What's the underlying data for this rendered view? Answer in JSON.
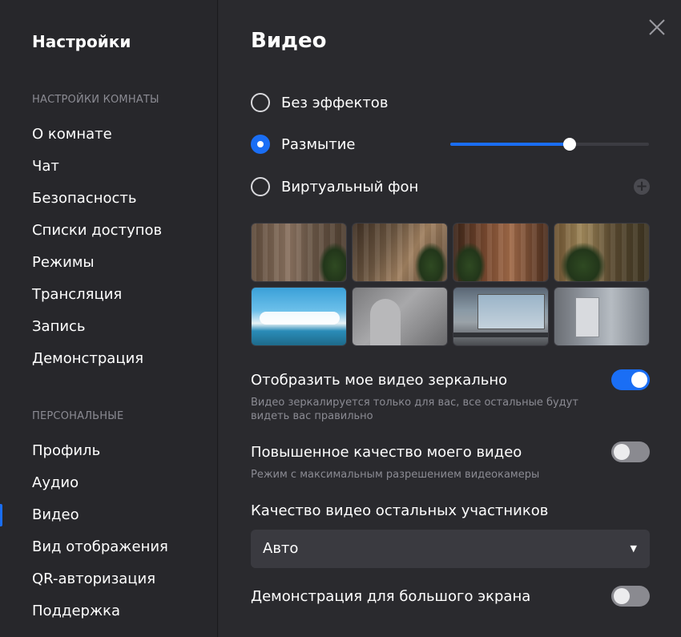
{
  "sidebar": {
    "title": "Настройки",
    "room_section": "НАСТРОЙКИ КОМНАТЫ",
    "room_items": [
      {
        "label": "О комнате"
      },
      {
        "label": "Чат"
      },
      {
        "label": "Безопасность"
      },
      {
        "label": "Списки доступов"
      },
      {
        "label": "Режимы"
      },
      {
        "label": "Трансляция"
      },
      {
        "label": "Запись"
      },
      {
        "label": "Демонстрация"
      }
    ],
    "personal_section": "ПЕРСОНАЛЬНЫЕ",
    "personal_items": [
      {
        "label": "Профиль"
      },
      {
        "label": "Аудио"
      },
      {
        "label": "Видео"
      },
      {
        "label": "Вид отображения"
      },
      {
        "label": "QR-авторизация"
      },
      {
        "label": "Поддержка"
      }
    ],
    "active_item": "Видео"
  },
  "main": {
    "title": "Видео",
    "effects": [
      {
        "label": "Без эффектов",
        "checked": false
      },
      {
        "label": "Размытие",
        "checked": true
      },
      {
        "label": "Виртуальный фон",
        "checked": false
      }
    ],
    "blur_level": 0.6,
    "add_background_icon": "plus-circle-icon",
    "backgrounds": [
      {
        "name": "bg-curtains"
      },
      {
        "name": "bg-blinds"
      },
      {
        "name": "bg-wood-room"
      },
      {
        "name": "bg-plants"
      },
      {
        "name": "bg-beach"
      },
      {
        "name": "bg-white-arch"
      },
      {
        "name": "bg-office-city"
      },
      {
        "name": "bg-grey-room"
      }
    ],
    "mirror": {
      "title": "Отобразить мое видео зеркально",
      "description_line1": "Видео зеркалируется только для вас, все остальные будут",
      "description_line2": "видеть вас правильно",
      "enabled": true
    },
    "hq": {
      "title": "Повышенное качество моего видео",
      "description": "Режим с максимальным разрешением видеокамеры",
      "enabled": false
    },
    "others_quality": {
      "title": "Качество видео остальных участников",
      "value": "Авто"
    },
    "big_screen": {
      "title": "Демонстрация для большого экрана",
      "enabled": false
    }
  },
  "colors": {
    "accent": "#1a6ef5",
    "background": "#27272b",
    "panel": "#2a2a2e",
    "muted_text": "#8b8b93"
  }
}
